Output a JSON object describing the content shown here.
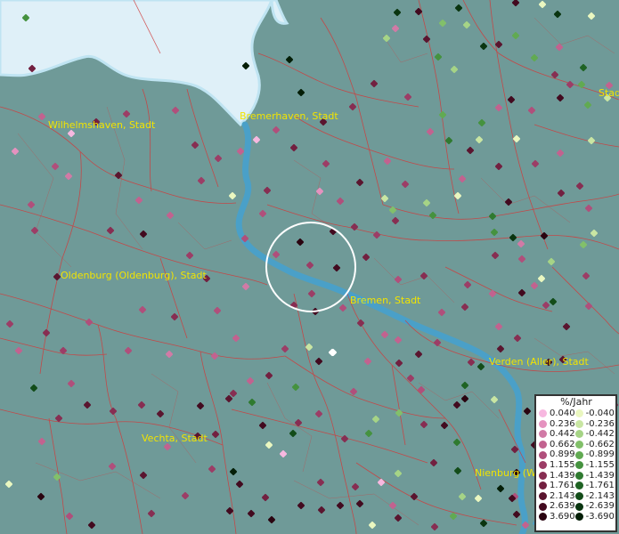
{
  "map": {
    "places": [
      {
        "name": "Wilhelmshaven, Stadt"
      },
      {
        "name": "Bremerhaven, Stadt"
      },
      {
        "name": "Oldenburg (Oldenburg), Stadt"
      },
      {
        "name": "Bremen, Stadt"
      },
      {
        "name": "Verden (Aller), Stadt"
      },
      {
        "name": "Vechta, Stadt"
      },
      {
        "name": "Nienburg (We"
      },
      {
        "name": "Stad"
      }
    ],
    "colors": {
      "water": "#dff0f8",
      "river": "#4aa0c8",
      "land": "#6f9a98",
      "boundary": "#d03c3c",
      "label": "#f2e400"
    },
    "highlight": {
      "shape": "circle",
      "color": "#ffffff"
    }
  },
  "legend": {
    "unit": "%/Jahr",
    "positive": [
      {
        "label": "0.040",
        "color": "#f7b8e0"
      },
      {
        "label": "0.236",
        "color": "#e592bf"
      },
      {
        "label": "0.442",
        "color": "#d17aa6"
      },
      {
        "label": "0.662",
        "color": "#c2628f"
      },
      {
        "label": "0.899",
        "color": "#b04f7b"
      },
      {
        "label": "1.155",
        "color": "#9c3d66"
      },
      {
        "label": "1.439",
        "color": "#872e52"
      },
      {
        "label": "1.761",
        "color": "#722040"
      },
      {
        "label": "2.143",
        "color": "#5a152f"
      },
      {
        "label": "2.639",
        "color": "#420a1f"
      },
      {
        "label": "3.690",
        "color": "#2a0410"
      }
    ],
    "negative": [
      {
        "label": "-0.040",
        "color": "#eaf7c0"
      },
      {
        "label": "-0.236",
        "color": "#c9e6a3"
      },
      {
        "label": "-0.442",
        "color": "#a6d486"
      },
      {
        "label": "-0.662",
        "color": "#82c06a"
      },
      {
        "label": "-0.899",
        "color": "#61aa52"
      },
      {
        "label": "-1.155",
        "color": "#45923f"
      },
      {
        "label": "-1.439",
        "color": "#2f7a30"
      },
      {
        "label": "-1.761",
        "color": "#1f6324"
      },
      {
        "label": "-2.143",
        "color": "#134c19"
      },
      {
        "label": "-2.639",
        "color": "#0a3510"
      },
      {
        "label": "-3.690",
        "color": "#041e07"
      }
    ]
  }
}
